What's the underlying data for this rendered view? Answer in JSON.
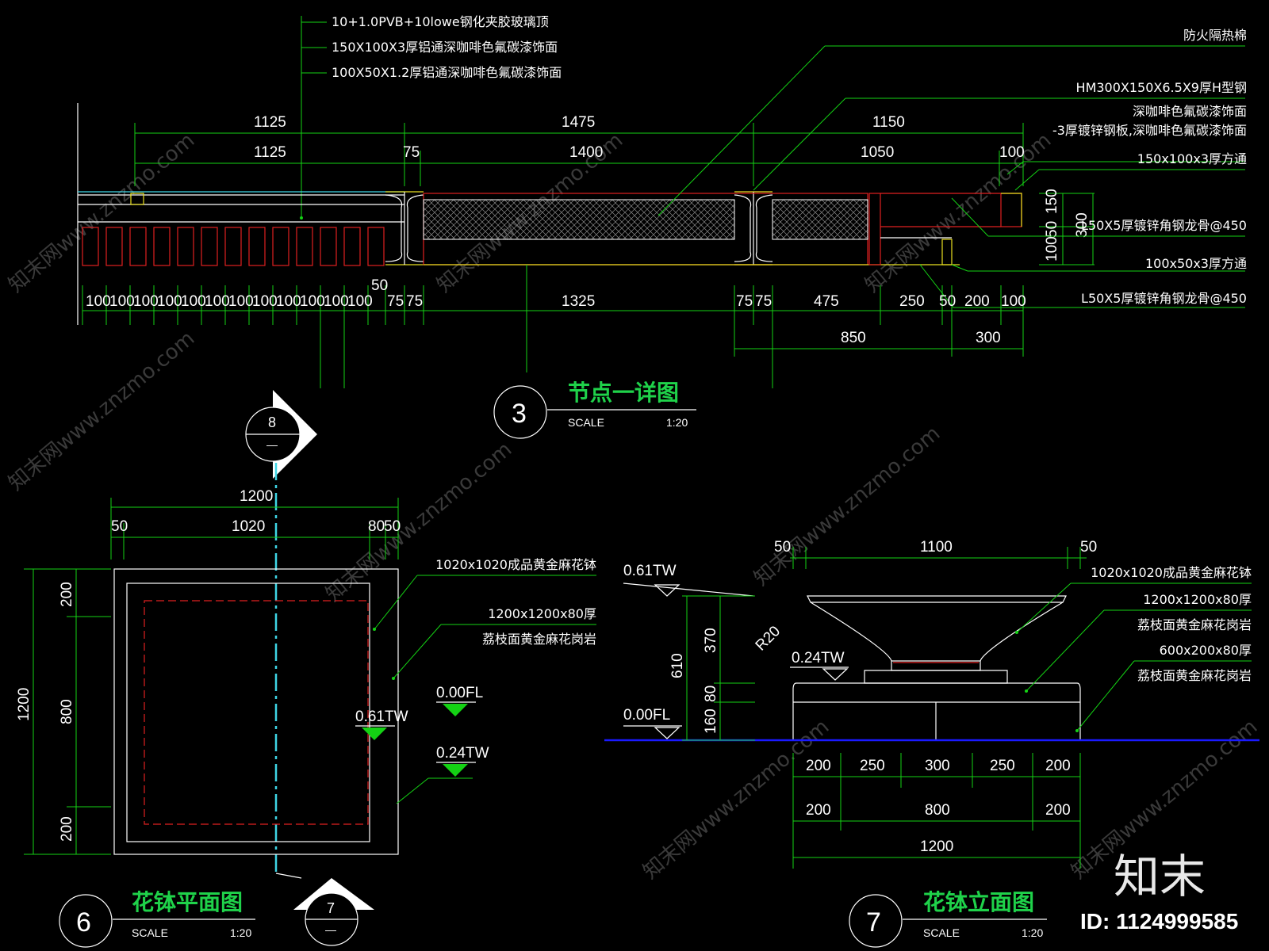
{
  "detail3": {
    "callouts_left": [
      "10+1.0PVB+10lowe钢化夹胶玻璃顶",
      "150X100X3厚铝通深咖啡色氟碳漆饰面",
      "100X50X1.2厚铝通深咖啡色氟碳漆饰面"
    ],
    "callouts_right": [
      "防火隔热棉",
      "HM300X150X6.5X9厚H型钢",
      "深咖啡色氟碳漆饰面",
      "-3厚镀锌钢板,深咖啡色氟碳漆饰面",
      "150x100x3厚方通",
      "L50X5厚镀锌角钢龙骨@450",
      "100x50x3厚方通",
      "L50X5厚镀锌角钢龙骨@450"
    ],
    "dim_top1": [
      "1125",
      "1475",
      "1150"
    ],
    "dim_top2": [
      "1125",
      "75",
      "1400",
      "1050",
      "100"
    ],
    "dim_bottom_small": [
      "100",
      "100",
      "100",
      "100",
      "100",
      "100",
      "100",
      "100",
      "100",
      "100",
      "100",
      "100",
      "75",
      "75"
    ],
    "dim_bottom_50": "50",
    "dim_bottom_main": [
      "1325",
      "75",
      "75",
      "475",
      "250",
      "50",
      "200",
      "100"
    ],
    "dim_bottom2": [
      "850",
      "300"
    ],
    "dim_right": [
      "150",
      "300",
      "100",
      "50"
    ],
    "tag_number": "3",
    "title": "节点一详图",
    "scale_label": "SCALE",
    "scale_value": "1:20"
  },
  "detail6": {
    "section_tag_top": {
      "number": "8",
      "sub": "—"
    },
    "section_tag_bottom": {
      "number": "7",
      "sub": "—"
    },
    "dim_top1": "1200",
    "dim_top2": [
      "50",
      "1020",
      "80",
      "50"
    ],
    "dim_left1": "1200",
    "dim_left2": [
      "200",
      "800",
      "200"
    ],
    "callouts": [
      "1020x1020成品黄金麻花钵",
      "1200x1200x80厚",
      "荔枝面黄金麻花岗岩"
    ],
    "levels": [
      "0.00FL",
      "0.61TW",
      "0.24TW"
    ],
    "tag_number": "6",
    "title": "花钵平面图",
    "scale_label": "SCALE",
    "scale_value": "1:20"
  },
  "detail7": {
    "dim_top": [
      "50",
      "1100",
      "50"
    ],
    "levels": [
      "0.61TW",
      "0.24TW",
      "0.00FL"
    ],
    "radius": "R20",
    "dim_left_outer": "610",
    "dim_left_inner": [
      "370",
      "80",
      "160"
    ],
    "callouts": [
      "1020x1020成品黄金麻花钵",
      "1200x1200x80厚",
      "荔枝面黄金麻花岗岩",
      "600x200x80厚",
      "荔枝面黄金麻花岗岩"
    ],
    "dim_bottom1": [
      "200",
      "250",
      "300",
      "250",
      "200"
    ],
    "dim_bottom2": [
      "200",
      "800",
      "200"
    ],
    "dim_bottom3": "1200",
    "tag_number": "7",
    "title": "花钵立面图",
    "scale_label": "SCALE",
    "scale_value": "1:20"
  },
  "branding": {
    "logo_text": "知末",
    "id_text": "ID: 1124999585",
    "watermark": "知末网www.znzmo.com"
  },
  "colors": {
    "background": "#000000",
    "dimension": "#14d214",
    "outline": "#ffffff",
    "cyan": "#3fd6e6",
    "red": "#e02020",
    "yellow": "#e8e020",
    "title": "#1fd24a",
    "ground": "#1a1aff"
  }
}
